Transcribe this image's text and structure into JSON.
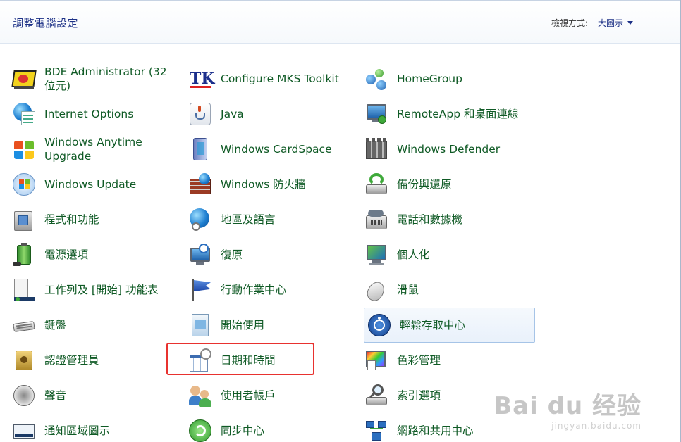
{
  "header": {
    "title": "調整電腦設定",
    "view_by_label": "檢視方式:",
    "view_by_value": "大圖示"
  },
  "columns": [
    [
      {
        "label": "BDE Administrator (32 位元)",
        "icon": "bde-admin-icon"
      },
      {
        "label": "Internet Options",
        "icon": "internet-options-icon"
      },
      {
        "label": "Windows Anytime Upgrade",
        "icon": "windows-anytime-upgrade-icon"
      },
      {
        "label": "Windows Update",
        "icon": "windows-update-icon"
      },
      {
        "label": "程式和功能",
        "icon": "programs-features-icon"
      },
      {
        "label": "電源選項",
        "icon": "power-options-icon"
      },
      {
        "label": "工作列及 [開始] 功能表",
        "icon": "taskbar-start-icon"
      },
      {
        "label": "鍵盤",
        "icon": "keyboard-icon"
      },
      {
        "label": "認證管理員",
        "icon": "credential-manager-icon"
      },
      {
        "label": "聲音",
        "icon": "sound-icon"
      },
      {
        "label": "通知區域圖示",
        "icon": "notification-area-icon"
      }
    ],
    [
      {
        "label": "Configure MKS Toolkit",
        "icon": "mks-toolkit-icon"
      },
      {
        "label": "Java",
        "icon": "java-icon"
      },
      {
        "label": "Windows CardSpace",
        "icon": "cardspace-icon"
      },
      {
        "label": "Windows 防火牆",
        "icon": "firewall-icon"
      },
      {
        "label": "地區及語言",
        "icon": "region-language-icon"
      },
      {
        "label": "復原",
        "icon": "recovery-icon"
      },
      {
        "label": "行動作業中心",
        "icon": "action-center-icon"
      },
      {
        "label": "開始使用",
        "icon": "getting-started-icon"
      },
      {
        "label": "日期和時間",
        "icon": "date-time-icon"
      },
      {
        "label": "使用者帳戶",
        "icon": "user-accounts-icon"
      },
      {
        "label": "同步中心",
        "icon": "sync-center-icon"
      }
    ],
    [
      {
        "label": "HomeGroup",
        "icon": "homegroup-icon"
      },
      {
        "label": "RemoteApp 和桌面連線",
        "icon": "remoteapp-icon"
      },
      {
        "label": "Windows Defender",
        "icon": "defender-icon"
      },
      {
        "label": "備份與還原",
        "icon": "backup-restore-icon"
      },
      {
        "label": "電話和數據機",
        "icon": "phone-modem-icon"
      },
      {
        "label": "個人化",
        "icon": "personalization-icon"
      },
      {
        "label": "滑鼠",
        "icon": "mouse-icon"
      },
      {
        "label": "輕鬆存取中心",
        "icon": "ease-of-access-icon"
      },
      {
        "label": "色彩管理",
        "icon": "color-management-icon"
      },
      {
        "label": "索引選項",
        "icon": "indexing-options-icon"
      },
      {
        "label": "網路和共用中心",
        "icon": "network-sharing-icon"
      }
    ]
  ],
  "watermark": {
    "brand": "Bai du 经验",
    "url": "jingyan.baidu.com"
  },
  "colors": {
    "link_green": "#0f5a25",
    "title_blue": "#1e3287",
    "highlight_red": "#e8322f"
  }
}
